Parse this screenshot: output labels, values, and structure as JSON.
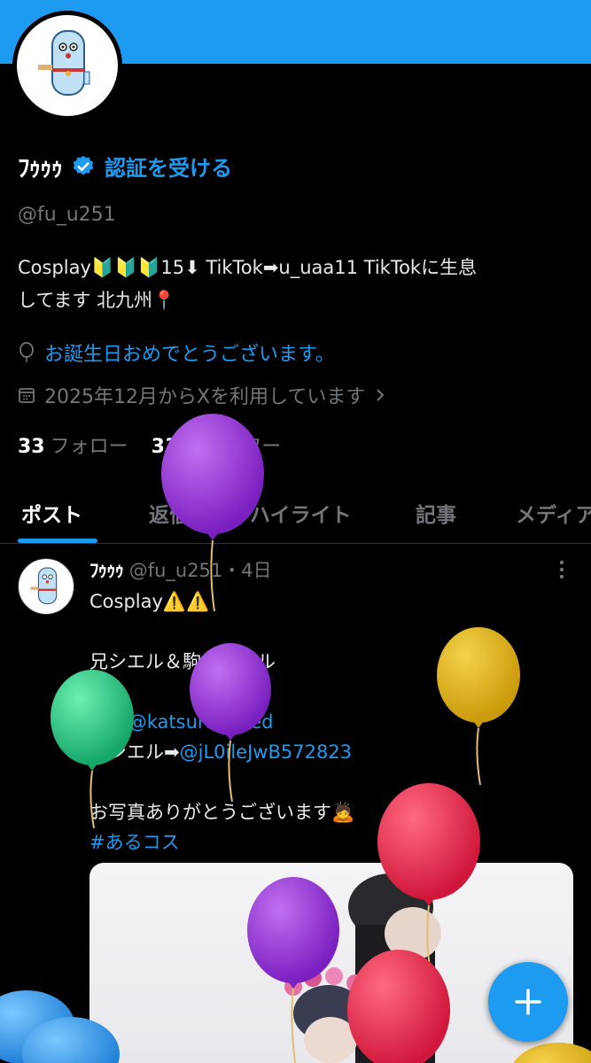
{
  "profile": {
    "display_name": "ﾌｩｩｩ",
    "verify_label": "認証を受ける",
    "handle": "@fu_u251",
    "bio_line1": "Cosplay🔰🔰🔰15⬇ TikTok➡u_uaa11 TikTokに生息",
    "bio_line2": "してます 北九州📍",
    "birthday": "お誕生日おめでとうございます。",
    "joined": "2025年12月からXを利用しています",
    "following_count": "33",
    "following_label": "フォロー",
    "followers_count": "33",
    "followers_label": "フォロワー"
  },
  "tabs": [
    "ポスト",
    "返信",
    "ハイライト",
    "記事",
    "メディア"
  ],
  "post": {
    "name": "ﾌｩｩｩ",
    "meta": "@fu_u251・4日",
    "line1": "Cosplay⚠️⚠️",
    "line2": "兄シエル＆駒鳥シエル",
    "camera_prefix": "📷➡",
    "camera_handle": "@katsuragi_red",
    "line4_prefix": "兄シエル➡",
    "line4_handle": "@jL0ileJwB572823",
    "line5": "お写真ありがとうございます🙇",
    "hashtag": "#あるコス"
  },
  "fab": {
    "label": "+"
  },
  "colors": {
    "accent": "#1d9bf0",
    "background": "#000000",
    "muted": "#71767b"
  }
}
